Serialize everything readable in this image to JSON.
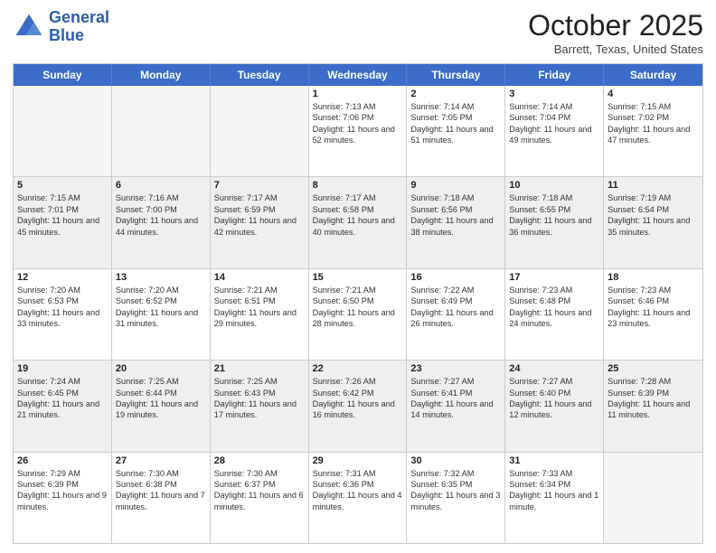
{
  "header": {
    "logo_line1": "General",
    "logo_line2": "Blue",
    "month": "October 2025",
    "location": "Barrett, Texas, United States"
  },
  "days_of_week": [
    "Sunday",
    "Monday",
    "Tuesday",
    "Wednesday",
    "Thursday",
    "Friday",
    "Saturday"
  ],
  "rows": [
    [
      {
        "day": "",
        "info": "",
        "empty": true
      },
      {
        "day": "",
        "info": "",
        "empty": true
      },
      {
        "day": "",
        "info": "",
        "empty": true
      },
      {
        "day": "1",
        "sunrise": "7:13 AM",
        "sunset": "7:06 PM",
        "daylight": "11 hours and 52 minutes."
      },
      {
        "day": "2",
        "sunrise": "7:14 AM",
        "sunset": "7:05 PM",
        "daylight": "11 hours and 51 minutes."
      },
      {
        "day": "3",
        "sunrise": "7:14 AM",
        "sunset": "7:04 PM",
        "daylight": "11 hours and 49 minutes."
      },
      {
        "day": "4",
        "sunrise": "7:15 AM",
        "sunset": "7:02 PM",
        "daylight": "11 hours and 47 minutes."
      }
    ],
    [
      {
        "day": "5",
        "sunrise": "7:15 AM",
        "sunset": "7:01 PM",
        "daylight": "11 hours and 45 minutes."
      },
      {
        "day": "6",
        "sunrise": "7:16 AM",
        "sunset": "7:00 PM",
        "daylight": "11 hours and 44 minutes."
      },
      {
        "day": "7",
        "sunrise": "7:17 AM",
        "sunset": "6:59 PM",
        "daylight": "11 hours and 42 minutes."
      },
      {
        "day": "8",
        "sunrise": "7:17 AM",
        "sunset": "6:58 PM",
        "daylight": "11 hours and 40 minutes."
      },
      {
        "day": "9",
        "sunrise": "7:18 AM",
        "sunset": "6:56 PM",
        "daylight": "11 hours and 38 minutes."
      },
      {
        "day": "10",
        "sunrise": "7:18 AM",
        "sunset": "6:55 PM",
        "daylight": "11 hours and 36 minutes."
      },
      {
        "day": "11",
        "sunrise": "7:19 AM",
        "sunset": "6:54 PM",
        "daylight": "11 hours and 35 minutes."
      }
    ],
    [
      {
        "day": "12",
        "sunrise": "7:20 AM",
        "sunset": "6:53 PM",
        "daylight": "11 hours and 33 minutes."
      },
      {
        "day": "13",
        "sunrise": "7:20 AM",
        "sunset": "6:52 PM",
        "daylight": "11 hours and 31 minutes."
      },
      {
        "day": "14",
        "sunrise": "7:21 AM",
        "sunset": "6:51 PM",
        "daylight": "11 hours and 29 minutes."
      },
      {
        "day": "15",
        "sunrise": "7:21 AM",
        "sunset": "6:50 PM",
        "daylight": "11 hours and 28 minutes."
      },
      {
        "day": "16",
        "sunrise": "7:22 AM",
        "sunset": "6:49 PM",
        "daylight": "11 hours and 26 minutes."
      },
      {
        "day": "17",
        "sunrise": "7:23 AM",
        "sunset": "6:48 PM",
        "daylight": "11 hours and 24 minutes."
      },
      {
        "day": "18",
        "sunrise": "7:23 AM",
        "sunset": "6:46 PM",
        "daylight": "11 hours and 23 minutes."
      }
    ],
    [
      {
        "day": "19",
        "sunrise": "7:24 AM",
        "sunset": "6:45 PM",
        "daylight": "11 hours and 21 minutes."
      },
      {
        "day": "20",
        "sunrise": "7:25 AM",
        "sunset": "6:44 PM",
        "daylight": "11 hours and 19 minutes."
      },
      {
        "day": "21",
        "sunrise": "7:25 AM",
        "sunset": "6:43 PM",
        "daylight": "11 hours and 17 minutes."
      },
      {
        "day": "22",
        "sunrise": "7:26 AM",
        "sunset": "6:42 PM",
        "daylight": "11 hours and 16 minutes."
      },
      {
        "day": "23",
        "sunrise": "7:27 AM",
        "sunset": "6:41 PM",
        "daylight": "11 hours and 14 minutes."
      },
      {
        "day": "24",
        "sunrise": "7:27 AM",
        "sunset": "6:40 PM",
        "daylight": "11 hours and 12 minutes."
      },
      {
        "day": "25",
        "sunrise": "7:28 AM",
        "sunset": "6:39 PM",
        "daylight": "11 hours and 11 minutes."
      }
    ],
    [
      {
        "day": "26",
        "sunrise": "7:29 AM",
        "sunset": "6:39 PM",
        "daylight": "11 hours and 9 minutes."
      },
      {
        "day": "27",
        "sunrise": "7:30 AM",
        "sunset": "6:38 PM",
        "daylight": "11 hours and 7 minutes."
      },
      {
        "day": "28",
        "sunrise": "7:30 AM",
        "sunset": "6:37 PM",
        "daylight": "11 hours and 6 minutes."
      },
      {
        "day": "29",
        "sunrise": "7:31 AM",
        "sunset": "6:36 PM",
        "daylight": "11 hours and 4 minutes."
      },
      {
        "day": "30",
        "sunrise": "7:32 AM",
        "sunset": "6:35 PM",
        "daylight": "11 hours and 3 minutes."
      },
      {
        "day": "31",
        "sunrise": "7:33 AM",
        "sunset": "6:34 PM",
        "daylight": "11 hours and 1 minute."
      },
      {
        "day": "",
        "info": "",
        "empty": true
      }
    ]
  ]
}
